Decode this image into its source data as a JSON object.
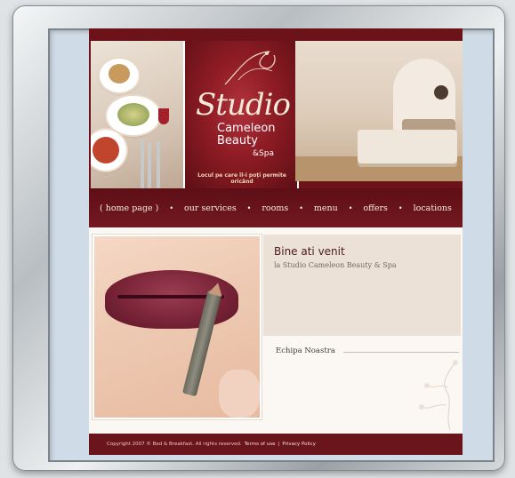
{
  "logo": {
    "studio": "Studio",
    "cameleon": "Cameleon",
    "beauty": "Beauty",
    "spa": "&Spa",
    "tagline": "Locul pe care îl-i poți permite oricând"
  },
  "nav": {
    "items": [
      "( home page )",
      "our services",
      "rooms",
      "menu",
      "offers",
      "locations"
    ]
  },
  "welcome": {
    "title": "Bine ati venit",
    "subtitle": "la Studio Cameleon Beauty & Spa"
  },
  "team": {
    "label": "Echipa Noastra"
  },
  "footer": {
    "copyright": "Copyright 2007 © Bed & Breakfast. All rights reserved.",
    "terms": "Terms of use",
    "separator": "|",
    "privacy": "Privacy Policy"
  },
  "colors": {
    "brand_maroon": "#6c1219",
    "nav_text": "#f8efe6",
    "welcome_bg": "#ebe1d6"
  }
}
